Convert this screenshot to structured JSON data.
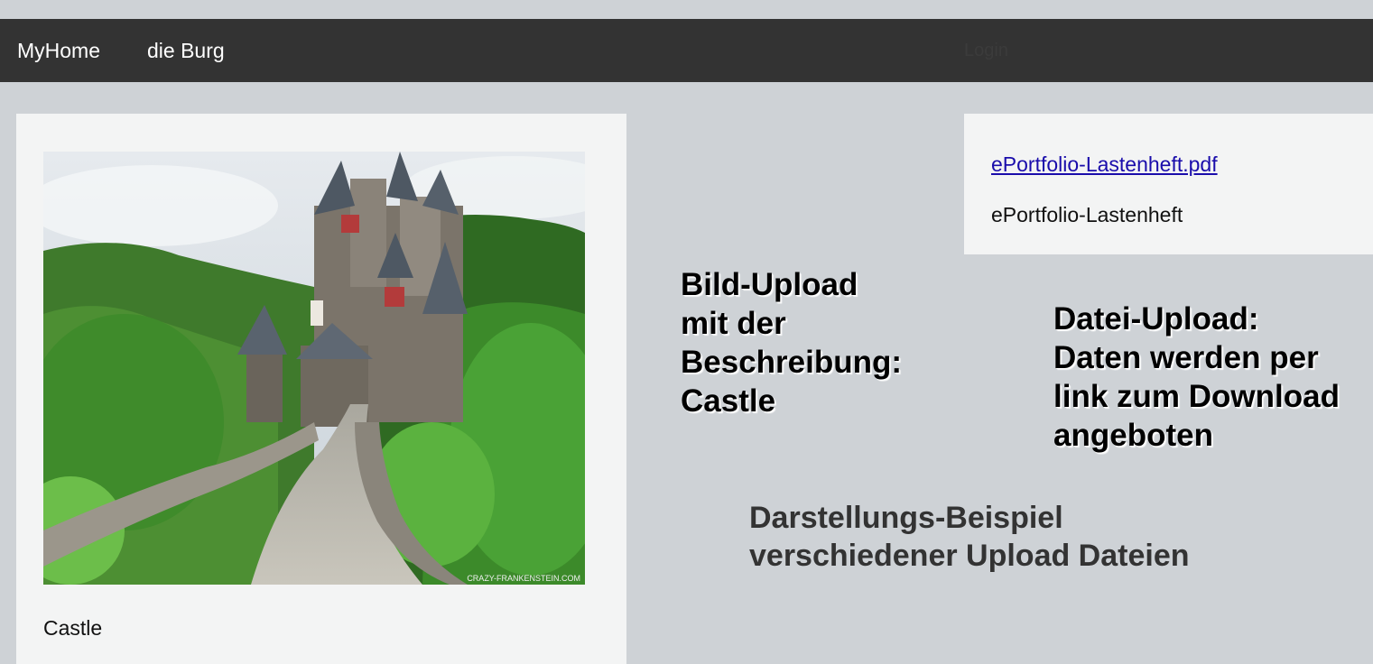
{
  "nav": {
    "items": [
      "MyHome",
      "die Burg"
    ],
    "faint_label": "Login"
  },
  "image_card": {
    "image_alt": "Castle photo",
    "image_watermark": "CRAZY-FRANKENSTEIN.COM",
    "caption": "Castle"
  },
  "file_card": {
    "link": "ePortfolio-Lastenheft.pdf",
    "description": "ePortfolio-Lastenheft"
  },
  "annotations": {
    "image_upload": [
      "Bild-Upload",
      "mit der",
      "Beschreibung:",
      "Castle"
    ],
    "file_upload": [
      "Datei-Upload:",
      "Daten werden per",
      "link zum Download",
      "angeboten"
    ],
    "demo": [
      "Darstellungs-Beispiel",
      "verschiedener Upload Dateien"
    ]
  },
  "colors": {
    "page_bg": "#ced2d6",
    "navbar_bg": "#333333",
    "card_bg": "#f3f4f4",
    "link": "#1a0dab"
  }
}
